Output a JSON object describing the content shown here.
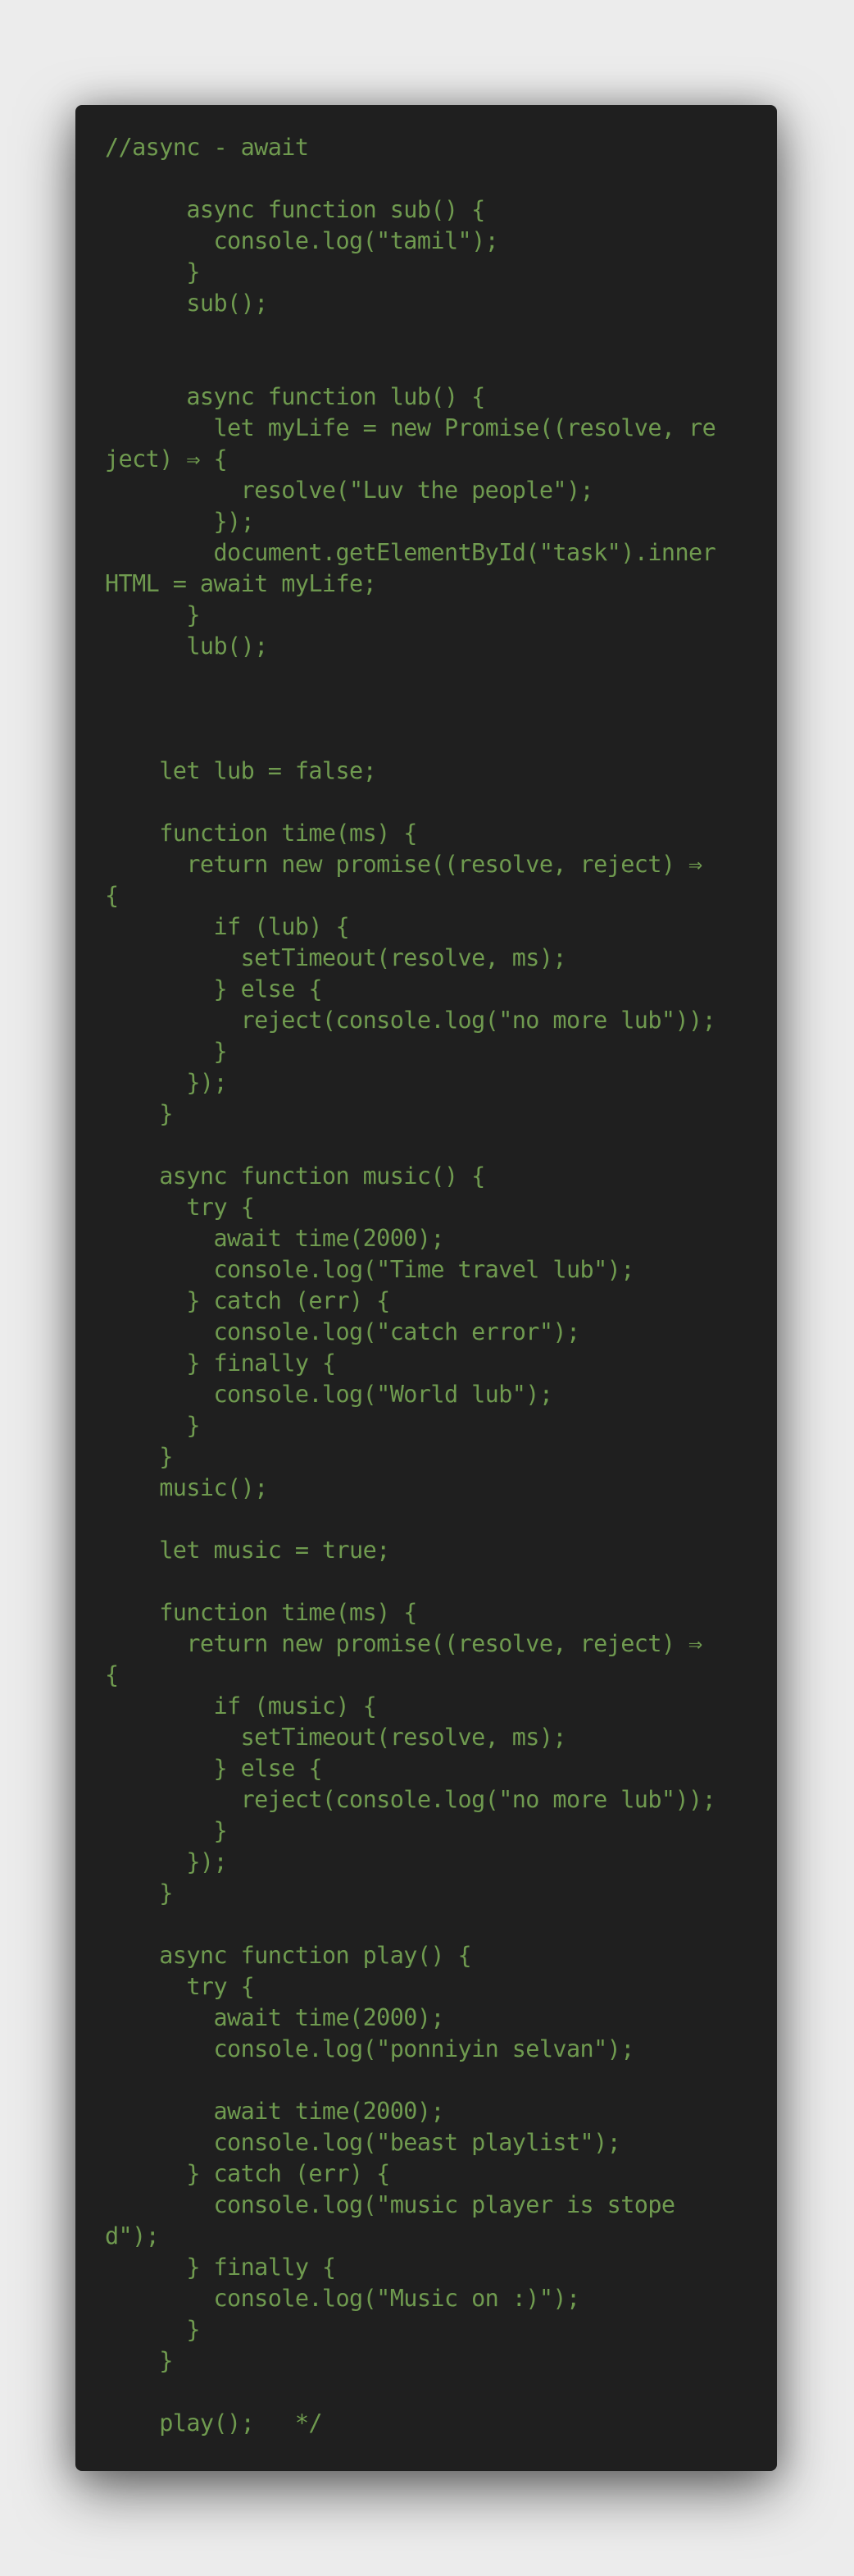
{
  "colors": {
    "page_background": "#ececec",
    "editor_background": "#1f1f1f",
    "code_text": "#6f9a4f"
  },
  "code": {
    "lines": [
      "//async - await",
      "",
      "      async function sub() {",
      "        console.log(\"tamil\");",
      "      }",
      "      sub();",
      "",
      "",
      "      async function lub() {",
      "        let myLife = new Promise((resolve, re",
      "ject) ⇒ {",
      "          resolve(\"Luv the people\");",
      "        });",
      "        document.getElementById(\"task\").inner",
      "HTML = await myLife;",
      "      }",
      "      lub();",
      "",
      "",
      "",
      "    let lub = false;",
      "",
      "    function time(ms) {",
      "      return new promise((resolve, reject) ⇒",
      "{",
      "        if (lub) {",
      "          setTimeout(resolve, ms);",
      "        } else {",
      "          reject(console.log(\"no more lub\"));",
      "        }",
      "      });",
      "    }",
      "",
      "    async function music() {",
      "      try {",
      "        await time(2000);",
      "        console.log(\"Time travel lub\");",
      "      } catch (err) {",
      "        console.log(\"catch error\");",
      "      } finally {",
      "        console.log(\"World lub\");",
      "      }",
      "    }",
      "    music();",
      "",
      "    let music = true;",
      "",
      "    function time(ms) {",
      "      return new promise((resolve, reject) ⇒",
      "{",
      "        if (music) {",
      "          setTimeout(resolve, ms);",
      "        } else {",
      "          reject(console.log(\"no more lub\"));",
      "        }",
      "      });",
      "    }",
      "",
      "    async function play() {",
      "      try {",
      "        await time(2000);",
      "        console.log(\"ponniyin selvan\");",
      "",
      "        await time(2000);",
      "        console.log(\"beast playlist\");",
      "      } catch (err) {",
      "        console.log(\"music player is stope",
      "d\");",
      "      } finally {",
      "        console.log(\"Music on :)\");",
      "      }",
      "    }",
      "",
      "    play();   */"
    ]
  }
}
